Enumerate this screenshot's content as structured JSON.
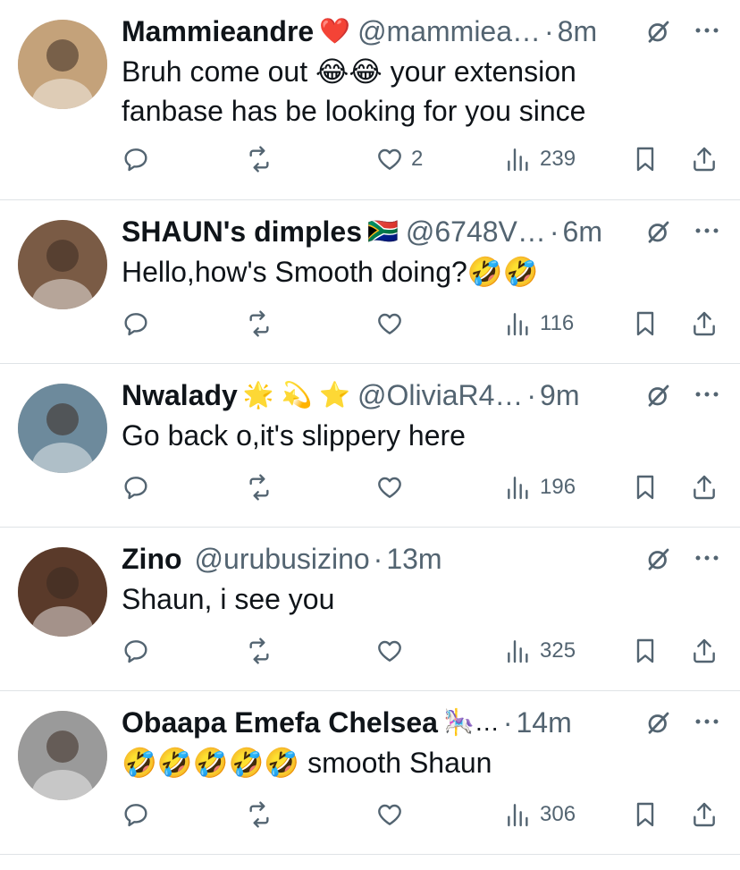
{
  "replies": [
    {
      "name": "Mammieandre",
      "name_emoji": "❤️",
      "handle": "@mammiea…",
      "time": "8m",
      "text": "Bruh come out 😂😂 your extension\nfanbase has be looking for you since",
      "likes": "2",
      "views": "239",
      "avatar_color": "#c4a27a"
    },
    {
      "name": "SHAUN's dimples",
      "name_emoji": "🇿🇦",
      "handle": "@6748V…",
      "time": "6m",
      "text": "Hello,how's Smooth doing?🤣🤣",
      "likes": "",
      "views": "116",
      "avatar_color": "#7a5b45"
    },
    {
      "name": "Nwalady",
      "name_emoji": "🌟 💫 ⭐",
      "handle": "@OliviaR4…",
      "time": "9m",
      "text": "Go back o,it's slippery here",
      "likes": "",
      "views": "196",
      "avatar_color": "#6d8a9c"
    },
    {
      "name": "Zino",
      "name_emoji": "",
      "handle": "@urubusizino",
      "time": "13m",
      "text": "Shaun, i see you",
      "likes": "",
      "views": "325",
      "avatar_color": "#5a3a2a"
    },
    {
      "name": "Obaapa Emefa Chelsea",
      "name_emoji": "🎠…",
      "handle": "",
      "time": "14m",
      "text": "🤣🤣🤣🤣🤣 smooth Shaun",
      "likes": "",
      "views": "306",
      "avatar_color": "#9a9a9a"
    }
  ],
  "icons": [
    "reply-icon",
    "retweet-icon",
    "like-icon",
    "views-icon",
    "bookmark-icon",
    "share-icon",
    "grok-icon",
    "more-icon"
  ],
  "colors": {
    "text": "#0f1419",
    "secondary": "#536471",
    "divider": "#dfe3e6"
  }
}
